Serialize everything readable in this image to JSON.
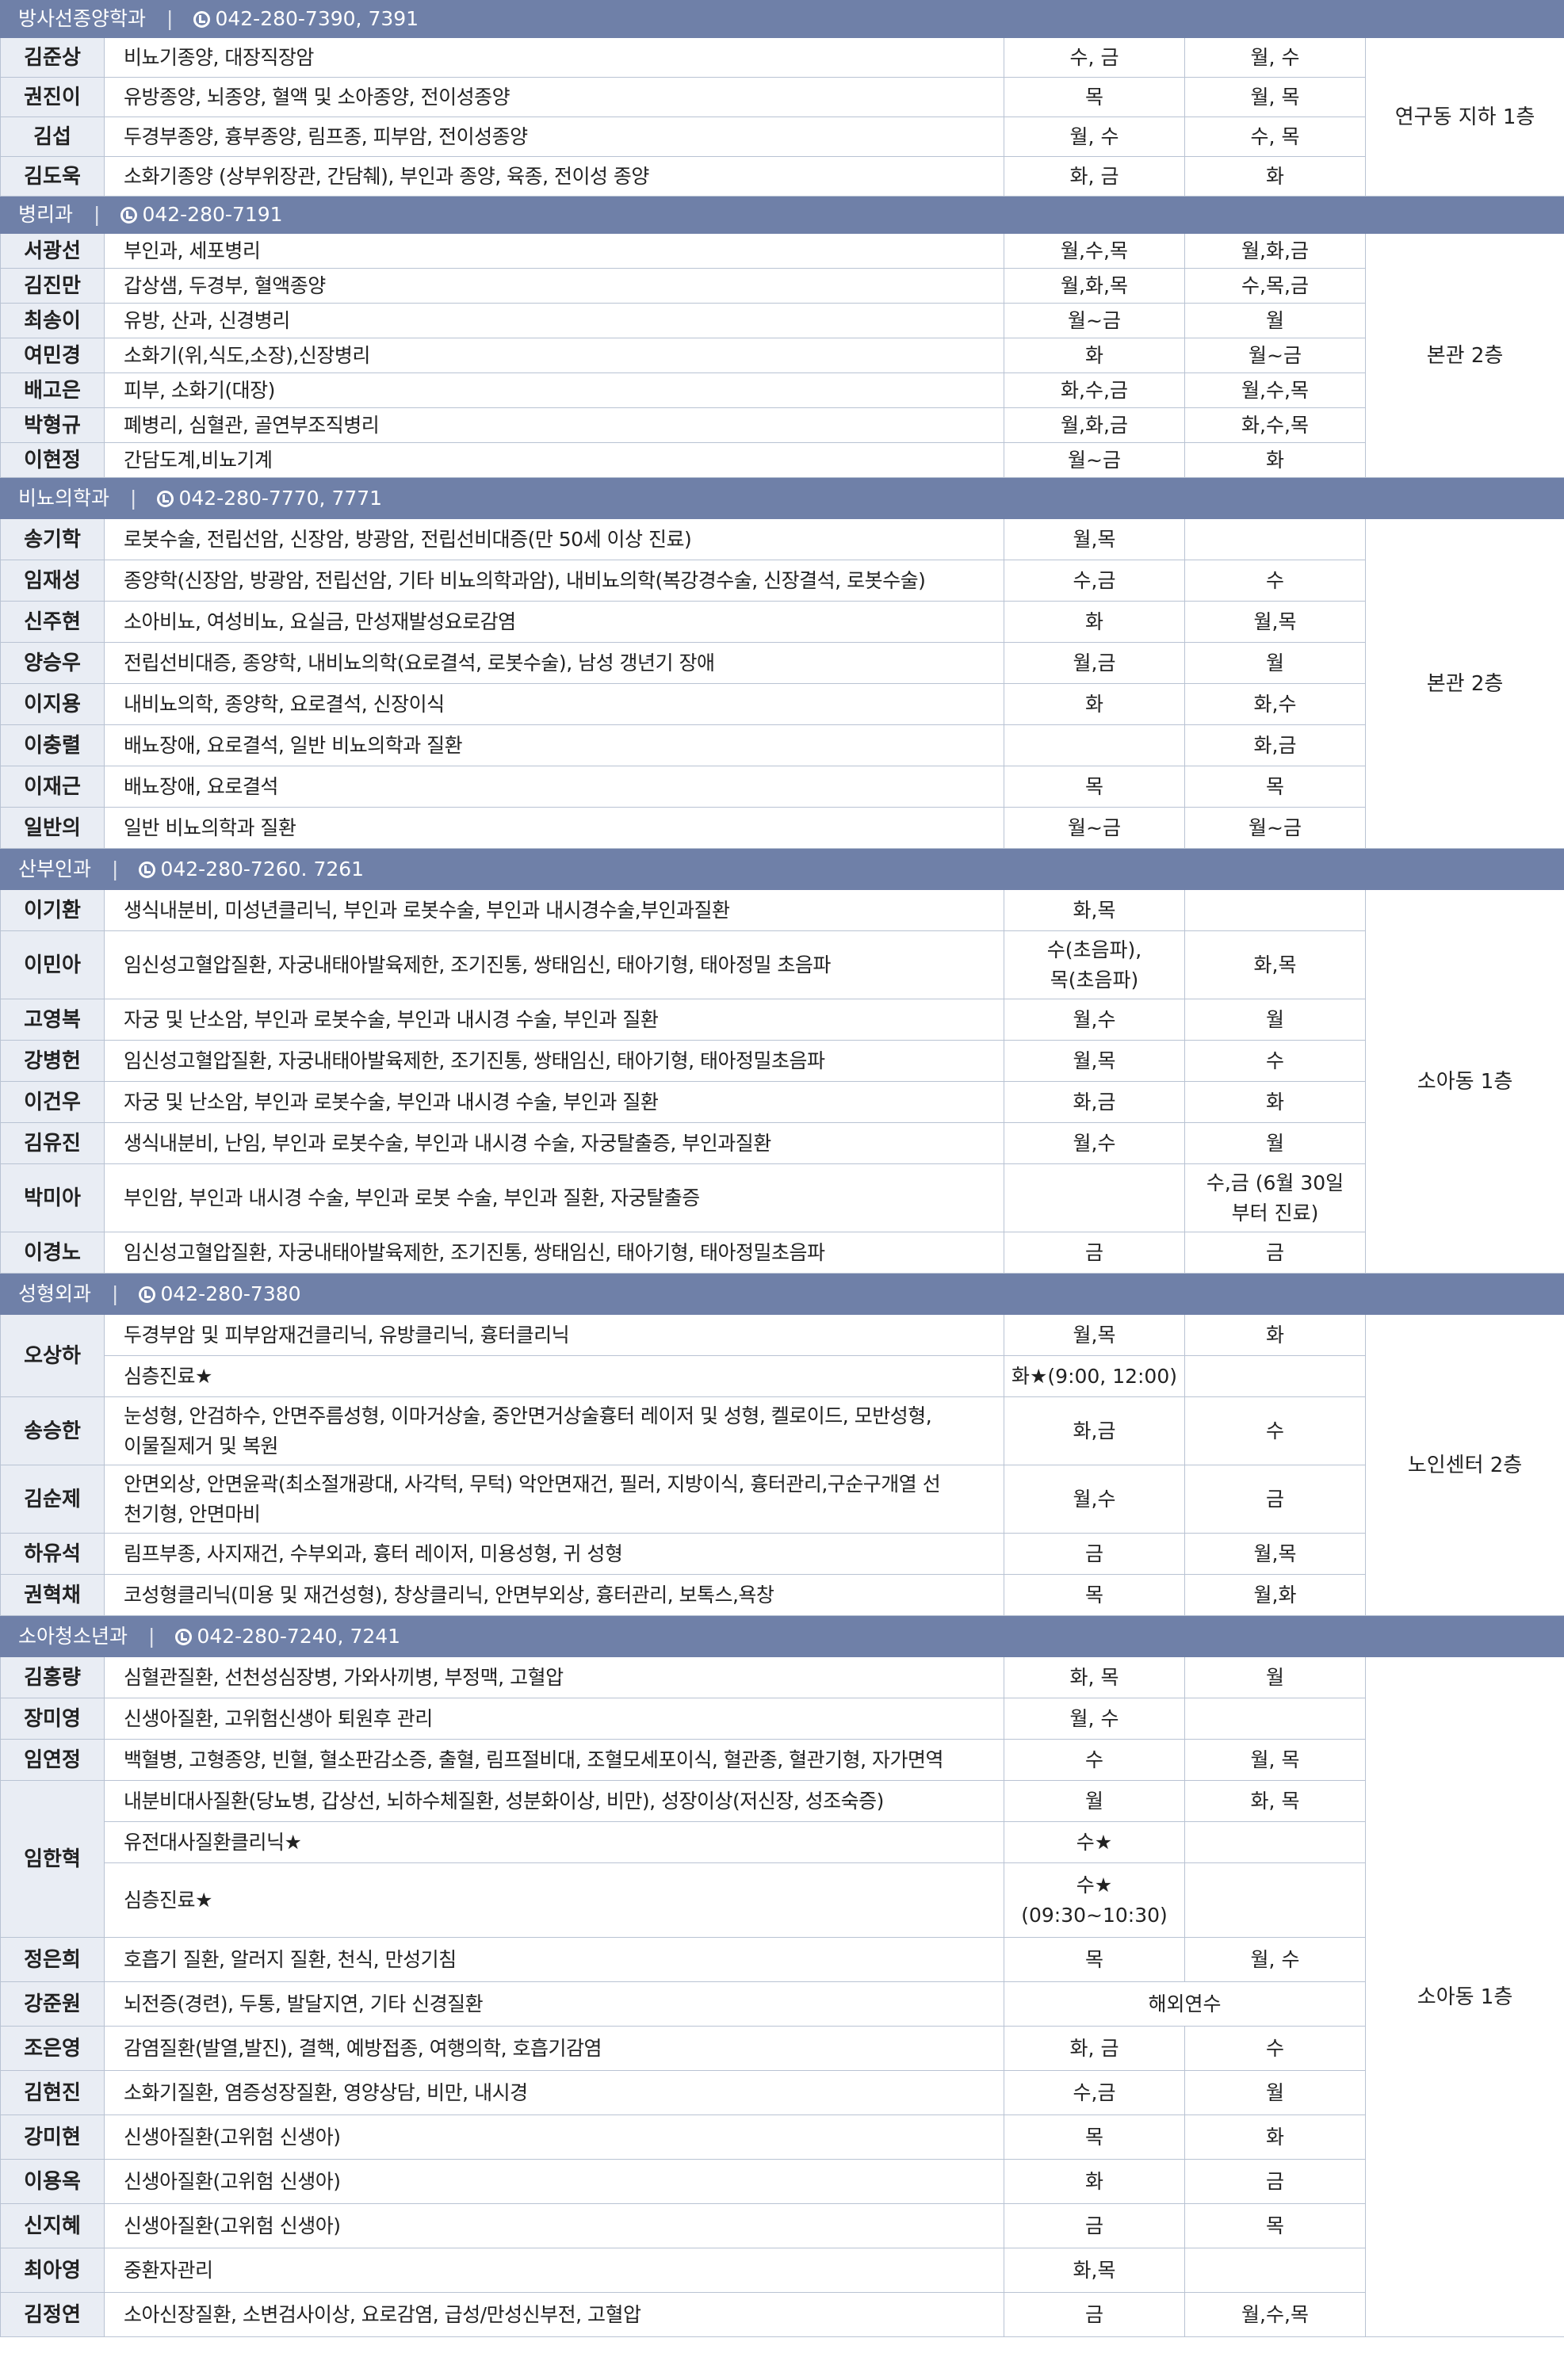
{
  "sections": [
    {
      "name": "방사선종양학과",
      "phone": "042-280-7390, 7391",
      "location": "연구동 지하 1층",
      "doctors": [
        {
          "name": "김준상",
          "rows": [
            {
              "spec": "비뇨기종양, 대장직장암",
              "am": "수, 금",
              "pm": "월, 수"
            }
          ]
        },
        {
          "name": "권진이",
          "rows": [
            {
              "spec": "유방종양, 뇌종양, 혈액 및 소아종양, 전이성종양",
              "am": "목",
              "pm": "월, 목"
            }
          ]
        },
        {
          "name": "김섭",
          "rows": [
            {
              "spec": "두경부종양, 흉부종양, 림프종, 피부암, 전이성종양",
              "am": "월, 수",
              "pm": "수, 목"
            }
          ]
        },
        {
          "name": "김도욱",
          "rows": [
            {
              "spec": "소화기종양 (상부위장관, 간담췌), 부인과 종양, 육종, 전이성 종양",
              "am": "화, 금",
              "pm": "화"
            }
          ]
        }
      ]
    },
    {
      "name": "병리과",
      "phone": "042-280-7191",
      "location": "본관 2층",
      "doctors": [
        {
          "name": "서광선",
          "rows": [
            {
              "spec": "부인과, 세포병리",
              "am": "월,수,목",
              "pm": "월,화,금"
            }
          ]
        },
        {
          "name": "김진만",
          "rows": [
            {
              "spec": "갑상샘, 두경부, 혈액종양",
              "am": "월,화,목",
              "pm": "수,목,금"
            }
          ]
        },
        {
          "name": "최송이",
          "rows": [
            {
              "spec": "유방, 산과, 신경병리",
              "am": "월~금",
              "pm": "월"
            }
          ]
        },
        {
          "name": "여민경",
          "rows": [
            {
              "spec": "소화기(위,식도,소장),신장병리",
              "am": "화",
              "pm": "월~금"
            }
          ]
        },
        {
          "name": "배고은",
          "rows": [
            {
              "spec": "피부, 소화기(대장)",
              "am": "화,수,금",
              "pm": "월,수,목"
            }
          ]
        },
        {
          "name": "박형규",
          "rows": [
            {
              "spec": "폐병리, 심혈관, 골연부조직병리",
              "am": "월,화,금",
              "pm": "화,수,목"
            }
          ]
        },
        {
          "name": "이현정",
          "rows": [
            {
              "spec": "간담도계,비뇨기계",
              "am": "월~금",
              "pm": "화"
            }
          ]
        }
      ]
    },
    {
      "name": "비뇨의학과",
      "phone": "042-280-7770, 7771",
      "location": "본관 2층",
      "doctors": [
        {
          "name": "송기학",
          "rows": [
            {
              "spec": "로봇수술, 전립선암, 신장암, 방광암, 전립선비대증(만 50세 이상 진료)",
              "am": "월,목",
              "pm": ""
            }
          ]
        },
        {
          "name": "임재성",
          "rows": [
            {
              "spec": "종양학(신장암, 방광암, 전립선암, 기타 비뇨의학과암), 내비뇨의학(복강경수술, 신장결석, 로봇수술)",
              "am": "수,금",
              "pm": "수"
            }
          ]
        },
        {
          "name": "신주현",
          "rows": [
            {
              "spec": "소아비뇨, 여성비뇨, 요실금, 만성재발성요로감염",
              "am": "화",
              "pm": "월,목"
            }
          ]
        },
        {
          "name": "양승우",
          "rows": [
            {
              "spec": "전립선비대증, 종양학, 내비뇨의학(요로결석, 로봇수술), 남성 갱년기 장애",
              "am": "월,금",
              "pm": "월"
            }
          ]
        },
        {
          "name": "이지용",
          "rows": [
            {
              "spec": "내비뇨의학, 종양학, 요로결석, 신장이식",
              "am": "화",
              "pm": "화,수"
            }
          ]
        },
        {
          "name": "이충렬",
          "rows": [
            {
              "spec": "배뇨장애, 요로결석, 일반 비뇨의학과 질환",
              "am": "",
              "pm": "화,금"
            }
          ]
        },
        {
          "name": "이재근",
          "rows": [
            {
              "spec": "배뇨장애, 요로결석",
              "am": "목",
              "pm": "목"
            }
          ]
        },
        {
          "name": "일반의",
          "rows": [
            {
              "spec": "일반 비뇨의학과 질환",
              "am": "월~금",
              "pm": "월~금"
            }
          ]
        }
      ]
    },
    {
      "name": "산부인과",
      "phone": "042-280-7260. 7261",
      "location": "소아동 1층",
      "doctors": [
        {
          "name": "이기환",
          "rows": [
            {
              "spec": "생식내분비, 미성년클리닉, 부인과 로봇수술, 부인과 내시경수술,부인과질환",
              "am": "화,목",
              "pm": ""
            }
          ]
        },
        {
          "name": "이민아",
          "rows": [
            {
              "spec": "임신성고혈압질환, 자궁내태아발육제한, 조기진통, 쌍태임신, 태아기형, 태아정밀 초음파",
              "am": "수(초음파),\n목(초음파)",
              "pm": "화,목"
            }
          ]
        },
        {
          "name": "고영복",
          "rows": [
            {
              "spec": "자궁 및 난소암, 부인과 로봇수술, 부인과 내시경 수술, 부인과 질환",
              "am": "월,수",
              "pm": "월"
            }
          ]
        },
        {
          "name": "강병헌",
          "rows": [
            {
              "spec": "임신성고혈압질환, 자궁내태아발육제한, 조기진통, 쌍태임신, 태아기형, 태아정밀초음파",
              "am": "월,목",
              "pm": "수"
            }
          ]
        },
        {
          "name": "이건우",
          "rows": [
            {
              "spec": "자궁 및 난소암, 부인과 로봇수술, 부인과 내시경 수술, 부인과 질환",
              "am": "화,금",
              "pm": "화"
            }
          ]
        },
        {
          "name": "김유진",
          "rows": [
            {
              "spec": "생식내분비, 난임, 부인과 로봇수술, 부인과 내시경 수술, 자궁탈출증, 부인과질환",
              "am": "월,수",
              "pm": "월"
            }
          ]
        },
        {
          "name": "박미아",
          "rows": [
            {
              "spec": "부인암, 부인과 내시경 수술, 부인과 로봇 수술, 부인과 질환, 자궁탈출증",
              "am": "",
              "pm": "수,금 (6월 30일\n부터 진료)"
            }
          ]
        },
        {
          "name": "이경노",
          "rows": [
            {
              "spec": "임신성고혈압질환, 자궁내태아발육제한, 조기진통, 쌍태임신, 태아기형, 태아정밀초음파",
              "am": "금",
              "pm": "금"
            }
          ]
        }
      ]
    },
    {
      "name": "성형외과",
      "phone": "042-280-7380",
      "location": "노인센터 2층",
      "doctors": [
        {
          "name": "오상하",
          "rows": [
            {
              "spec": "두경부암 및 피부암재건클리닉, 유방클리닉, 흉터클리닉",
              "am": "월,목",
              "pm": "화"
            },
            {
              "spec": "심층진료★",
              "am": "화★(9:00, 12:00)",
              "pm": ""
            }
          ]
        },
        {
          "name": "송승한",
          "rows": [
            {
              "spec": "눈성형, 안검하수, 안면주름성형, 이마거상술, 중안면거상술흉터 레이저 및 성형, 켈로이드, 모반성형,\n이물질제거 및 복원",
              "am": "화,금",
              "pm": "수"
            }
          ]
        },
        {
          "name": "김순제",
          "rows": [
            {
              "spec": "안면외상, 안면윤곽(최소절개광대, 사각턱, 무턱) 악안면재건, 필러, 지방이식, 흉터관리,구순구개열 선\n천기형, 안면마비",
              "am": "월,수",
              "pm": "금"
            }
          ]
        },
        {
          "name": "하유석",
          "rows": [
            {
              "spec": "림프부종, 사지재건, 수부외과, 흉터 레이저, 미용성형, 귀 성형",
              "am": "금",
              "pm": "월,목"
            }
          ]
        },
        {
          "name": "권혁채",
          "rows": [
            {
              "spec": "코성형클리닉(미용 및 재건성형), 창상클리닉, 안면부외상, 흉터관리, 보톡스,욕창",
              "am": "목",
              "pm": "월,화"
            }
          ]
        }
      ]
    },
    {
      "name": "소아청소년과",
      "phone": "042-280-7240, 7241",
      "location": "소아동 1층",
      "doctors": [
        {
          "name": "김홍량",
          "rows": [
            {
              "spec": "심혈관질환, 선천성심장병, 가와사끼병, 부정맥, 고혈압",
              "am": "화, 목",
              "pm": "월"
            }
          ]
        },
        {
          "name": "장미영",
          "rows": [
            {
              "spec": "신생아질환, 고위험신생아 퇴원후 관리",
              "am": "월, 수",
              "pm": ""
            }
          ]
        },
        {
          "name": "임연정",
          "rows": [
            {
              "spec": "백혈병, 고형종양, 빈혈, 혈소판감소증, 출혈, 림프절비대, 조혈모세포이식, 혈관종, 혈관기형, 자가면역",
              "am": "수",
              "pm": "월, 목"
            }
          ]
        },
        {
          "name": "임한혁",
          "rows": [
            {
              "spec": "내분비대사질환(당뇨병, 갑상선, 뇌하수체질환, 성분화이상, 비만), 성장이상(저신장, 성조숙증)",
              "am": "월",
              "pm": "화, 목"
            },
            {
              "spec": "유전대사질환클리닉★",
              "am": "수★",
              "pm": ""
            },
            {
              "spec": "심층진료★",
              "am": "수★\n(09:30~10:30)",
              "pm": ""
            }
          ]
        },
        {
          "name": "정은희",
          "rows": [
            {
              "spec": "호흡기 질환, 알러지 질환, 천식, 만성기침",
              "am": "목",
              "pm": "월, 수"
            }
          ]
        },
        {
          "name": "강준원",
          "rows": [
            {
              "spec": "뇌전증(경련), 두통, 발달지연, 기타 신경질환",
              "span": "해외연수"
            }
          ]
        },
        {
          "name": "조은영",
          "rows": [
            {
              "spec": "감염질환(발열,발진), 결핵, 예방접종, 여행의학, 호흡기감염",
              "am": "화, 금",
              "pm": "수"
            }
          ]
        },
        {
          "name": "김현진",
          "rows": [
            {
              "spec": "소화기질환, 염증성장질환, 영양상담, 비만, 내시경",
              "am": "수,금",
              "pm": "월"
            }
          ]
        },
        {
          "name": "강미현",
          "rows": [
            {
              "spec": "신생아질환(고위험 신생아)",
              "am": "목",
              "pm": "화"
            }
          ]
        },
        {
          "name": "이용옥",
          "rows": [
            {
              "spec": "신생아질환(고위험 신생아)",
              "am": "화",
              "pm": "금"
            }
          ]
        },
        {
          "name": "신지혜",
          "rows": [
            {
              "spec": "신생아질환(고위험 신생아)",
              "am": "금",
              "pm": "목"
            }
          ]
        },
        {
          "name": "최아영",
          "rows": [
            {
              "spec": "중환자관리",
              "am": "화,목",
              "pm": ""
            }
          ]
        },
        {
          "name": "김정연",
          "rows": [
            {
              "spec": "소아신장질환, 소변검사이상, 요로감염, 급성/만성신부전, 고혈압",
              "am": "금",
              "pm": "월,수,목"
            }
          ]
        }
      ]
    }
  ]
}
